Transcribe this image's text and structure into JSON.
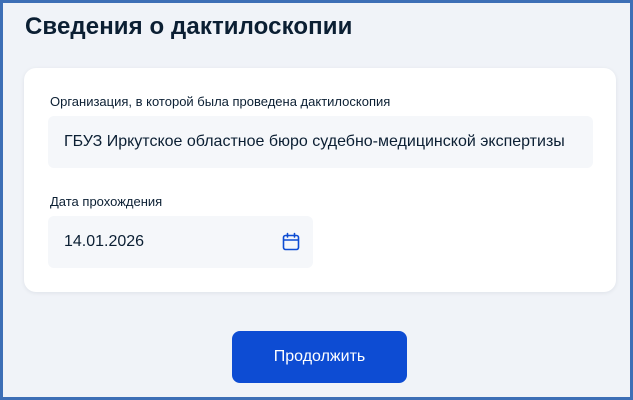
{
  "page": {
    "title": "Сведения о дактилоскопии"
  },
  "form": {
    "organization": {
      "label": "Организация, в которой была проведена дактилоскопия",
      "value": "ГБУЗ Иркутское областное бюро судебно-медицинской экспертизы"
    },
    "date": {
      "label": "Дата прохождения",
      "value": "14.01.2026",
      "icon": "calendar-icon"
    }
  },
  "actions": {
    "continue_label": "Продолжить"
  },
  "colors": {
    "primary": "#0d4cd3",
    "text": "#0b1f33",
    "input_bg": "#f5f7fa",
    "page_bg": "#f0f3f8",
    "frame_border": "#3d6fb6"
  }
}
